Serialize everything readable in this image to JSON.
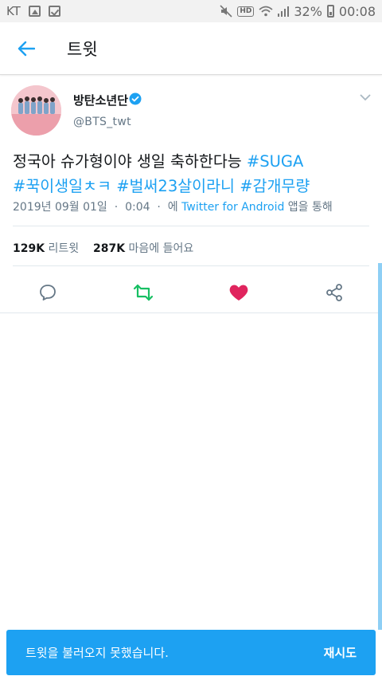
{
  "status_bar": {
    "carrier": "KT",
    "hd": "HD",
    "battery": "32%",
    "time": "00:08"
  },
  "header": {
    "title": "트윗"
  },
  "tweet": {
    "name": "방탄소년단",
    "handle": "@BTS_twt",
    "text_plain": "정국아 슈가형이야 생일 축하한다능 ",
    "hashtags": [
      "#SUGA",
      "#꾹이생일ㅊㅋ",
      "#벌써23살이라니",
      "#감개무량"
    ],
    "date": "2019년 09월 01일",
    "time": "0:04",
    "via_prefix": "에",
    "source": "Twitter for Android",
    "via_suffix": "앱을 통해",
    "retweets_count": "129K",
    "retweets_label": "리트윗",
    "likes_count": "287K",
    "likes_label": "마음에 들어요"
  },
  "colors": {
    "accent": "#1da1f2",
    "retweet": "#17bf63",
    "like": "#e0245e"
  },
  "toast": {
    "message": "트윗을 불러오지 못했습니다.",
    "action": "재시도"
  }
}
